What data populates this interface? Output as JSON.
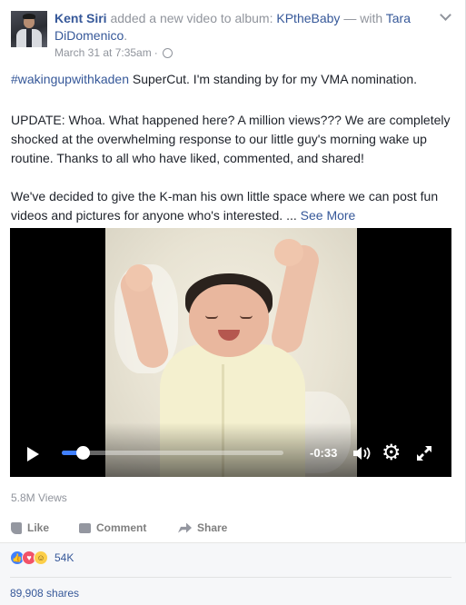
{
  "post": {
    "author": "Kent Siri",
    "action_text": "added a new video to album:",
    "album": "KPtheBaby",
    "with_text": "— with",
    "tagged": "Tara DiDomenico",
    "tagged_suffix": ".",
    "timestamp": "March 31 at 7:35am",
    "separator": "·",
    "privacy_icon": "globe-icon",
    "menu_icon": "chevron-down-icon"
  },
  "body": {
    "p1_hashtag": "#wakingupwithkaden",
    "p1_text": " SuperCut. I'm standing by for my VMA nomination.",
    "p2": "UPDATE: Whoa. What happened here? A million views??? We are completely shocked at the overwhelming response to our little guy's morning wake up routine. Thanks to all who have liked, commented, and shared!",
    "p3": "We've decided to give the K-man his own little space where we can post fun videos and pictures for anyone who's interested. ...",
    "see_more": "See More"
  },
  "video": {
    "time_remaining": "-0:33",
    "progress": 0.1,
    "controls": {
      "play_icon": "play-icon",
      "volume_icon": "volume-icon",
      "settings_icon": "gear-icon",
      "fullscreen_icon": "fullscreen-icon"
    }
  },
  "stats": {
    "views": "5.8M Views",
    "reactions_count": "54K",
    "shares": "89,908 shares"
  },
  "actions": {
    "like": "Like",
    "comment": "Comment",
    "share": "Share"
  },
  "colors": {
    "link": "#365899",
    "muted": "#90949c",
    "progress": "#4080ff",
    "like_reaction": "#4080ff",
    "love_reaction": "#f25268",
    "haha_reaction": "#fccf4a"
  }
}
